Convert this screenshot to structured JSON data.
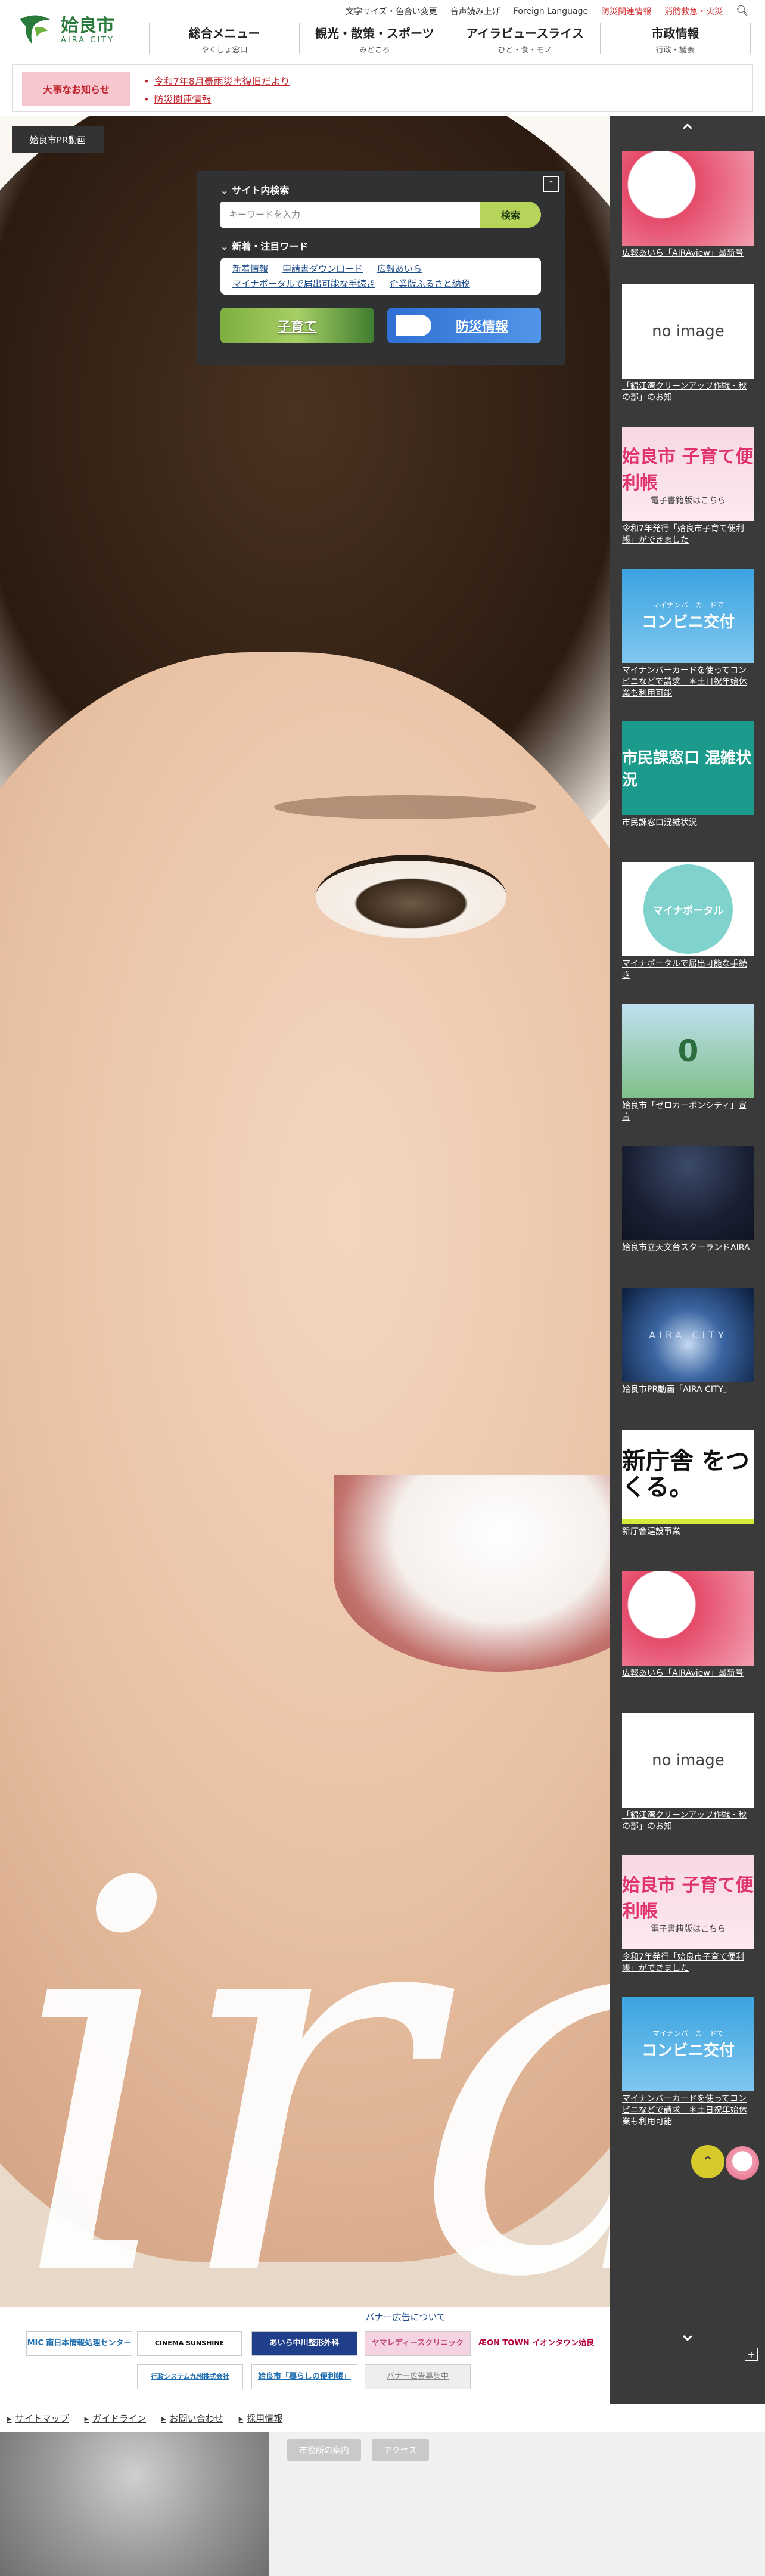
{
  "header": {
    "logo": {
      "ja": "姶良市",
      "en": "AIRA CITY"
    },
    "utility": [
      "文字サイズ・色合い変更",
      "音声読み上げ",
      "Foreign Language",
      "防災関連情報",
      "消防救急・火災"
    ],
    "nav": [
      {
        "main": "総合メニュー",
        "sub": "やくしょ窓口"
      },
      {
        "main": "観光・散策・スポーツ",
        "sub": "みどころ"
      },
      {
        "main": "アイラビュースライス",
        "sub": "ひと・食・モノ"
      },
      {
        "main": "市政情報",
        "sub": "行政・議会"
      }
    ]
  },
  "notice": {
    "label": "大事なお知らせ",
    "items": [
      "令和7年8月豪雨災害復旧だより",
      "防災関連情報"
    ]
  },
  "hero": {
    "badge": "姶良市PR動画",
    "word": "ira"
  },
  "search": {
    "site_search_label": "サイト内検索",
    "placeholder": "キーワードを入力",
    "button": "検索",
    "keywords_label": "新着・注目ワード",
    "keywords": [
      "新着情報",
      "申請書ダウンロード",
      "広報あいら",
      "マイナポータルで届出可能な手続き",
      "企業版ふるさと納税"
    ],
    "banner_kids": "子育て",
    "banner_bousai": "防災情報"
  },
  "sidebar": {
    "items": [
      {
        "caption": "広報あいら「AIRAview」最新号",
        "thumb": ""
      },
      {
        "caption": "「錦江湾クリーンアップ作戦・秋の部」のお知",
        "thumb": "no image"
      },
      {
        "caption": "令和7年発行「姶良市子育て便利帳」ができました",
        "thumb": "姶良市 子育て便利帳",
        "thumb_sub": "電子書籍版はこちら"
      },
      {
        "caption": "マイナンバーカードを使ってコンビニなどで請求　＊土日祝年始休業も利用可能",
        "thumb": "コンビニ交付",
        "thumb_sub": "マイナンバーカードで"
      },
      {
        "caption": "市民課窓口混雑状況",
        "thumb": "市民課窓口 混雑状況"
      },
      {
        "caption": "マイナポータルで届出可能な手続き",
        "thumb": "マイナポータル"
      },
      {
        "caption": "姶良市「ゼロカーボンシティ」宣言",
        "thumb": "0"
      },
      {
        "caption": "姶良市立天文台スターランドAIRA",
        "thumb": ""
      },
      {
        "caption": "姶良市PR動画「AIRA CITY」",
        "thumb": "AIRA CITY"
      },
      {
        "caption": "新庁舎建設事業",
        "thumb": "新庁舎 をつくる。"
      },
      {
        "caption": "広報あいら「AIRAview」最新号",
        "thumb": ""
      },
      {
        "caption": "「錦江湾クリーンアップ作戦・秋の部」のお知",
        "thumb": "no image"
      },
      {
        "caption": "令和7年発行「姶良市子育て便利帳」ができました",
        "thumb": "姶良市 子育て便利帳",
        "thumb_sub": "電子書籍版はこちら"
      },
      {
        "caption": "マイナンバーカードを使ってコンビニなどで請求　＊土日祝年始休業も利用可能",
        "thumb": "コンビニ交付",
        "thumb_sub": "マイナンバーカードで"
      }
    ]
  },
  "banners": {
    "link": "バナー広告について",
    "items": [
      {
        "text": "MIC 南日本情報処理センター",
        "color": "#1f6fb2"
      },
      {
        "text": "CINEMA SUNSHINE",
        "color": "#111111"
      },
      {
        "text": "あいら中川整形外科",
        "color": "#1f3f8a"
      },
      {
        "text": "ヤマレディースクリニック",
        "color": "#c2407a"
      },
      {
        "text": "ÆON TOWN イオンタウン姶良",
        "color": "#b4003e"
      },
      {
        "text": "行政システム九州株式会社",
        "color": "#1f6fb2"
      },
      {
        "text": "姶良市「暮らしの便利帳」",
        "color": "#1f6fb2"
      },
      {
        "text": "バナー広告募集中",
        "color": "#888888"
      }
    ]
  },
  "footer": {
    "links": [
      "サイトマップ",
      "ガイドライン",
      "お問い合わせ",
      "採用情報"
    ],
    "buttons": [
      "市役所の案内",
      "アクセス"
    ]
  },
  "colors": {
    "brand_green": "#2a7a3b",
    "alert_red": "#c1262e",
    "panel_dark": "#2f3133",
    "search_button": "#b6d35a",
    "sidebar_bg": "#3a3a3a"
  }
}
